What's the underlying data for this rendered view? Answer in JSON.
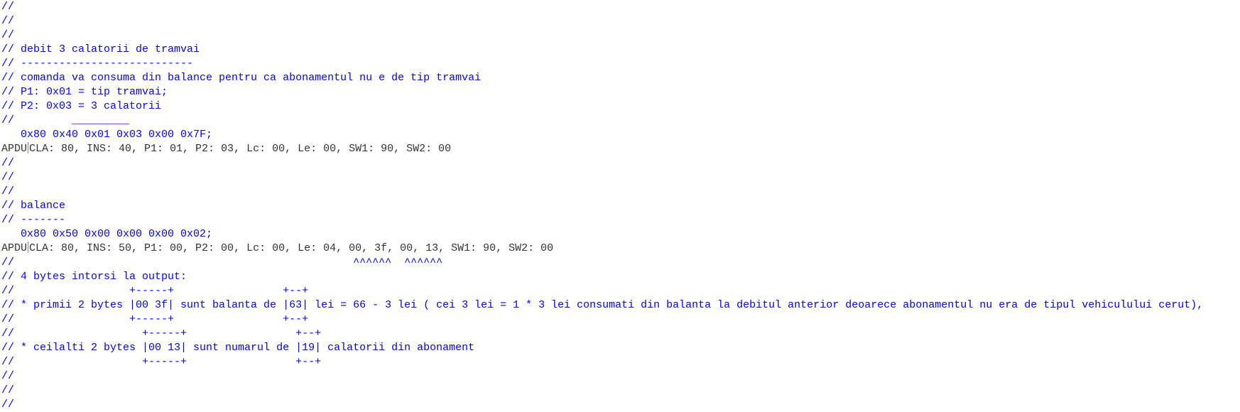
{
  "colors": {
    "comment": "#0000ff",
    "output": "#333333"
  },
  "lines": [
    {
      "text": "//"
    },
    {
      "text": "//"
    },
    {
      "text": "//"
    },
    {
      "text": "// debit 3 calatorii de tramvai"
    },
    {
      "text": "// ---------------------------"
    },
    {
      "text": "// comanda va consuma din balance pentru ca abonamentul nu e de tip tramvai"
    },
    {
      "text": "// P1: 0x01 = tip tramvai;"
    },
    {
      "text": "// P2: 0x03 = 3 calatorii"
    },
    {
      "text": "//         _________"
    },
    {
      "text": "   0x80 0x40 0x01 0x03 0x00 0x7F;"
    },
    {
      "label": "APDU",
      "text": "CLA: 80, INS: 40, P1: 01, P2: 03, Lc: 00, Le: 00, SW1: 90, SW2: 00"
    },
    {
      "text": "//"
    },
    {
      "text": "//"
    },
    {
      "text": "//"
    },
    {
      "text": "// balance"
    },
    {
      "text": "// -------"
    },
    {
      "text": "   0x80 0x50 0x00 0x00 0x00 0x02;"
    },
    {
      "label": "APDU",
      "text": "CLA: 80, INS: 50, P1: 00, P2: 00, Lc: 00, Le: 04, 00, 3f, 00, 13, SW1: 90, SW2: 00"
    },
    {
      "text": "//                                                     ^^^^^^  ^^^^^^"
    },
    {
      "text": "// 4 bytes intorsi la output:"
    },
    {
      "text": "//                  +-----+                 +--+"
    },
    {
      "text": "// * primii 2 bytes |00 3f| sunt balanta de |63| lei = 66 - 3 lei ( cei 3 lei = 1 * 3 lei consumati din balanta la debitul anterior deoarece abonamentul nu era de tipul vehiculului cerut),"
    },
    {
      "text": "//                  +-----+                 +--+"
    },
    {
      "text": "//                    +-----+                 +--+"
    },
    {
      "text": "// * ceilalti 2 bytes |00 13| sunt numarul de |19| calatorii din abonament"
    },
    {
      "text": "//                    +-----+                 +--+"
    },
    {
      "text": "//"
    },
    {
      "text": "//"
    },
    {
      "text": "//"
    }
  ]
}
